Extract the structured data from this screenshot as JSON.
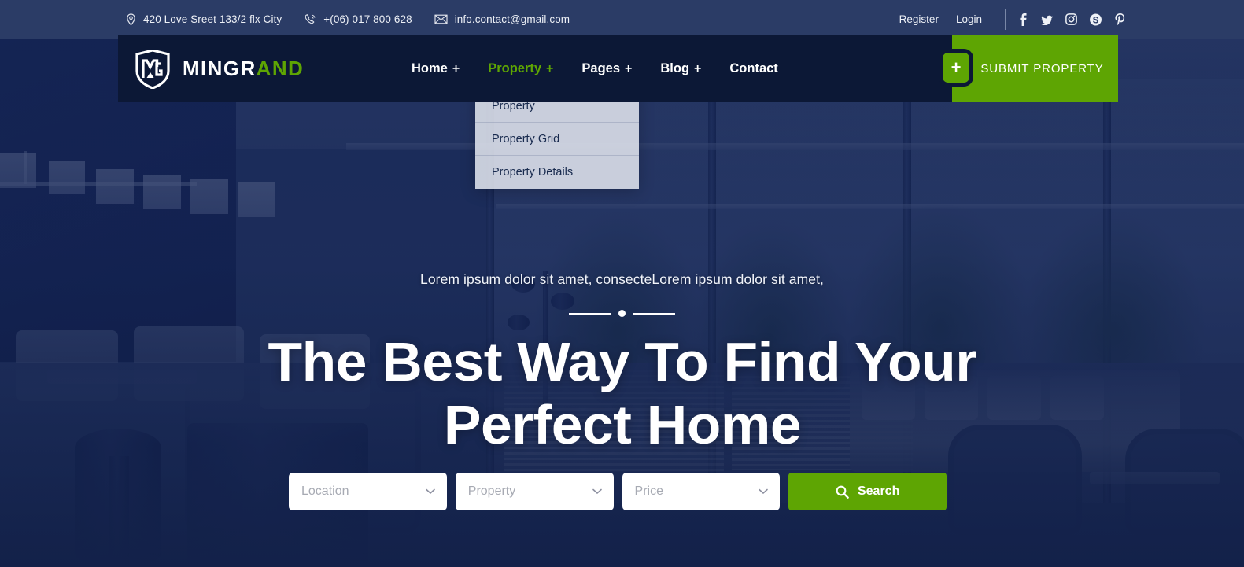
{
  "colors": {
    "accent_green": "#5ea503",
    "header_navy": "#0c1836",
    "topbar_navy": "#2b3c66",
    "hero_tint": "#102050",
    "dropdown_bg": "#e4e8f0",
    "placeholder_gray": "#a7aab3"
  },
  "topbar": {
    "contacts": [
      {
        "icon": "map-pin-icon",
        "text": "420 Love Sreet 133/2 flx City"
      },
      {
        "icon": "phone-icon",
        "text": "+(06) 017 800 628"
      },
      {
        "icon": "envelope-icon",
        "text": "info.contact@gmail.com"
      }
    ],
    "auth": [
      {
        "label": "Register",
        "name": "register-link"
      },
      {
        "label": "Login",
        "name": "login-link"
      }
    ],
    "socials": [
      {
        "icon": "facebook-icon",
        "label": "Facebook"
      },
      {
        "icon": "twitter-icon",
        "label": "Twitter"
      },
      {
        "icon": "instagram-icon",
        "label": "Instagram"
      },
      {
        "icon": "skype-icon",
        "label": "Skype"
      },
      {
        "icon": "pinterest-icon",
        "label": "Pinterest"
      }
    ]
  },
  "header": {
    "brand": {
      "primary": "MINGR",
      "accent": "AND",
      "logo_icon": "shield-mg-monogram-icon"
    },
    "nav": [
      {
        "label": "Home",
        "plus": "+",
        "active": false
      },
      {
        "label": "Property",
        "plus": "+",
        "active": true
      },
      {
        "label": "Pages",
        "plus": "+",
        "active": false
      },
      {
        "label": "Blog",
        "plus": "+",
        "active": false
      },
      {
        "label": "Contact",
        "plus": "",
        "active": false
      }
    ],
    "search_icon": "search-icon",
    "plus_button_label": "+",
    "submit_property_label": "SUBMIT PROPERTY"
  },
  "dropdown": {
    "parent": "Property",
    "open": true,
    "items": [
      {
        "label": "Property"
      },
      {
        "label": "Property Grid"
      },
      {
        "label": "Property Details"
      }
    ]
  },
  "hero": {
    "subtitle": "Lorem ipsum dolor sit amet, consecteLorem ipsum dolor sit amet,",
    "title": "The Best Way To Find Your Perfect Home",
    "slider": {
      "current_index": 1,
      "total": 1
    }
  },
  "search_panel": {
    "fields": [
      {
        "name": "location-select",
        "placeholder": "Location",
        "value": "",
        "icon": "chevron-down-icon"
      },
      {
        "name": "property-select",
        "placeholder": "Property",
        "value": "",
        "icon": "chevron-down-icon"
      },
      {
        "name": "price-select",
        "placeholder": "Price",
        "value": "",
        "icon": "chevron-down-icon"
      }
    ],
    "button": {
      "label": "Search",
      "icon": "search-icon"
    }
  }
}
